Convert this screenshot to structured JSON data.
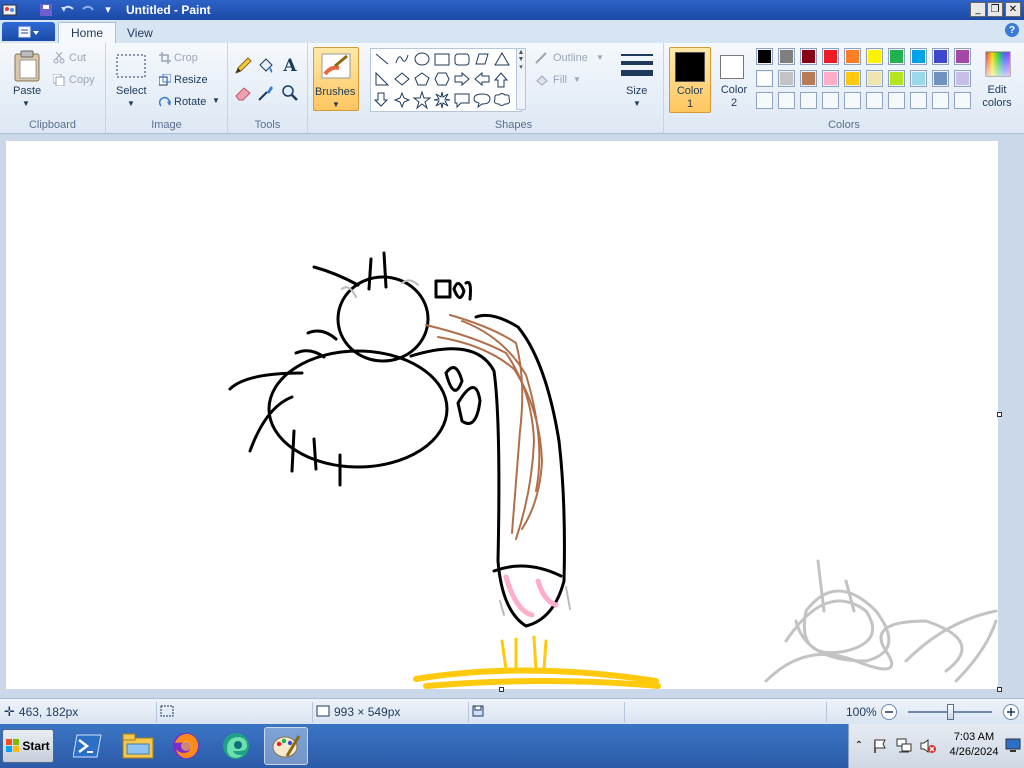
{
  "window": {
    "title": "Untitled - Paint"
  },
  "tabs": [
    {
      "label": "Home",
      "active": true
    },
    {
      "label": "View",
      "active": false
    }
  ],
  "ribbon": {
    "clipboard": {
      "paste_label": "Paste",
      "cut_label": "Cut",
      "copy_label": "Copy",
      "group_label": "Clipboard"
    },
    "image": {
      "select_label": "Select",
      "crop_label": "Crop",
      "resize_label": "Resize",
      "rotate_label": "Rotate",
      "group_label": "Image"
    },
    "tools": {
      "group_label": "Tools"
    },
    "brushes": {
      "label": "Brushes"
    },
    "shapes": {
      "outline_label": "Outline",
      "fill_label": "Fill",
      "group_label": "Shapes"
    },
    "size": {
      "label": "Size"
    },
    "colors": {
      "color1_label": "Color\n1",
      "color2_label": "Color\n2",
      "edit_label": "Edit\ncolors",
      "group_label": "Colors",
      "color1": "#000000",
      "color2": "#ffffff",
      "palette_row1": [
        "#000000",
        "#7f7f7f",
        "#880015",
        "#ed1c24",
        "#ff7f27",
        "#fff200",
        "#22b14c",
        "#00a2e8",
        "#3f48cc",
        "#a349a4"
      ],
      "palette_row2": [
        "#ffffff",
        "#c3c3c3",
        "#b97a57",
        "#ffaec9",
        "#ffc90e",
        "#efe4b0",
        "#b5e61d",
        "#99d9ea",
        "#7092be",
        "#c8bfe7"
      ]
    }
  },
  "statusbar": {
    "cursor_pos": "463, 182px",
    "canvas_size": "993 × 549px",
    "zoom": "100%"
  },
  "taskbar": {
    "start_label": "Start",
    "time": "7:03 AM",
    "date": "4/26/2024"
  }
}
